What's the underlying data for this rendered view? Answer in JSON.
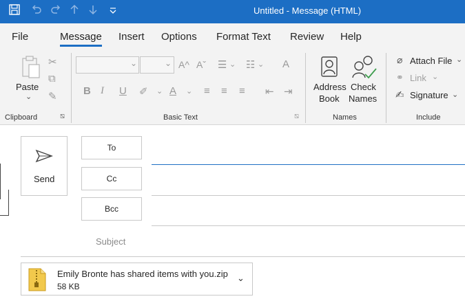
{
  "titlebar": {
    "title": "Untitled  -  Message (HTML)",
    "icons": [
      "save-icon",
      "undo-icon",
      "redo-icon",
      "up-arrow-icon",
      "down-arrow-icon",
      "customize-qat-icon"
    ],
    "color": "#1c6ec4"
  },
  "menu": {
    "items": [
      "File",
      "Message",
      "Insert",
      "Options",
      "Format Text",
      "Review",
      "Help"
    ],
    "active": "Message"
  },
  "ribbon": {
    "clipboard": {
      "paste": "Paste",
      "group_label": "Clipboard"
    },
    "basic_text": {
      "group_label": "Basic Text",
      "bold": "B",
      "italic": "I",
      "underline": "U",
      "grow_font": "A^",
      "shrink_font": "Aˇ"
    },
    "names": {
      "address_book_line1": "Address",
      "address_book_line2": "Book",
      "check_names_line1": "Check",
      "check_names_line2": "Names",
      "group_label": "Names"
    },
    "include": {
      "attach_file": "Attach File",
      "link": "Link",
      "signature": "Signature",
      "group_label": "Include"
    }
  },
  "compose": {
    "send": "Send",
    "to": "To",
    "cc": "Cc",
    "bcc": "Bcc",
    "subject": "Subject",
    "attachment": {
      "name": "Emily Bronte has shared items with you.zip",
      "size": "58 KB"
    }
  }
}
